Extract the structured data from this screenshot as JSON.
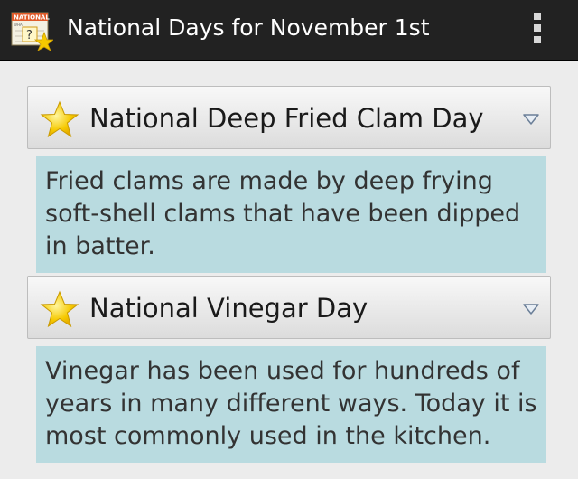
{
  "action_bar": {
    "title": "National Days for November 1st",
    "app_icon": "national-days-calendar-icon",
    "app_icon_text_top": "NATIONAL",
    "app_icon_text_side": "WHAT",
    "app_icon_text_center": "?",
    "overflow_icon": "overflow-menu-icon"
  },
  "items": [
    {
      "title": "National Deep Fried Clam Day",
      "description": "Fried clams are made by deep frying soft-shell clams that have been dipped in batter.",
      "icon": "star-icon",
      "expand_icon": "chevron-down-icon"
    },
    {
      "title": "National Vinegar Day",
      "description": "Vinegar has been used for hundreds of years in many different ways. Today it is most commonly used in the kitchen.",
      "icon": "star-icon",
      "expand_icon": "chevron-down-icon"
    }
  ],
  "colors": {
    "action_bar_bg": "#222222",
    "description_bg": "#b9dbe0",
    "star_fill": "#f6c900"
  }
}
